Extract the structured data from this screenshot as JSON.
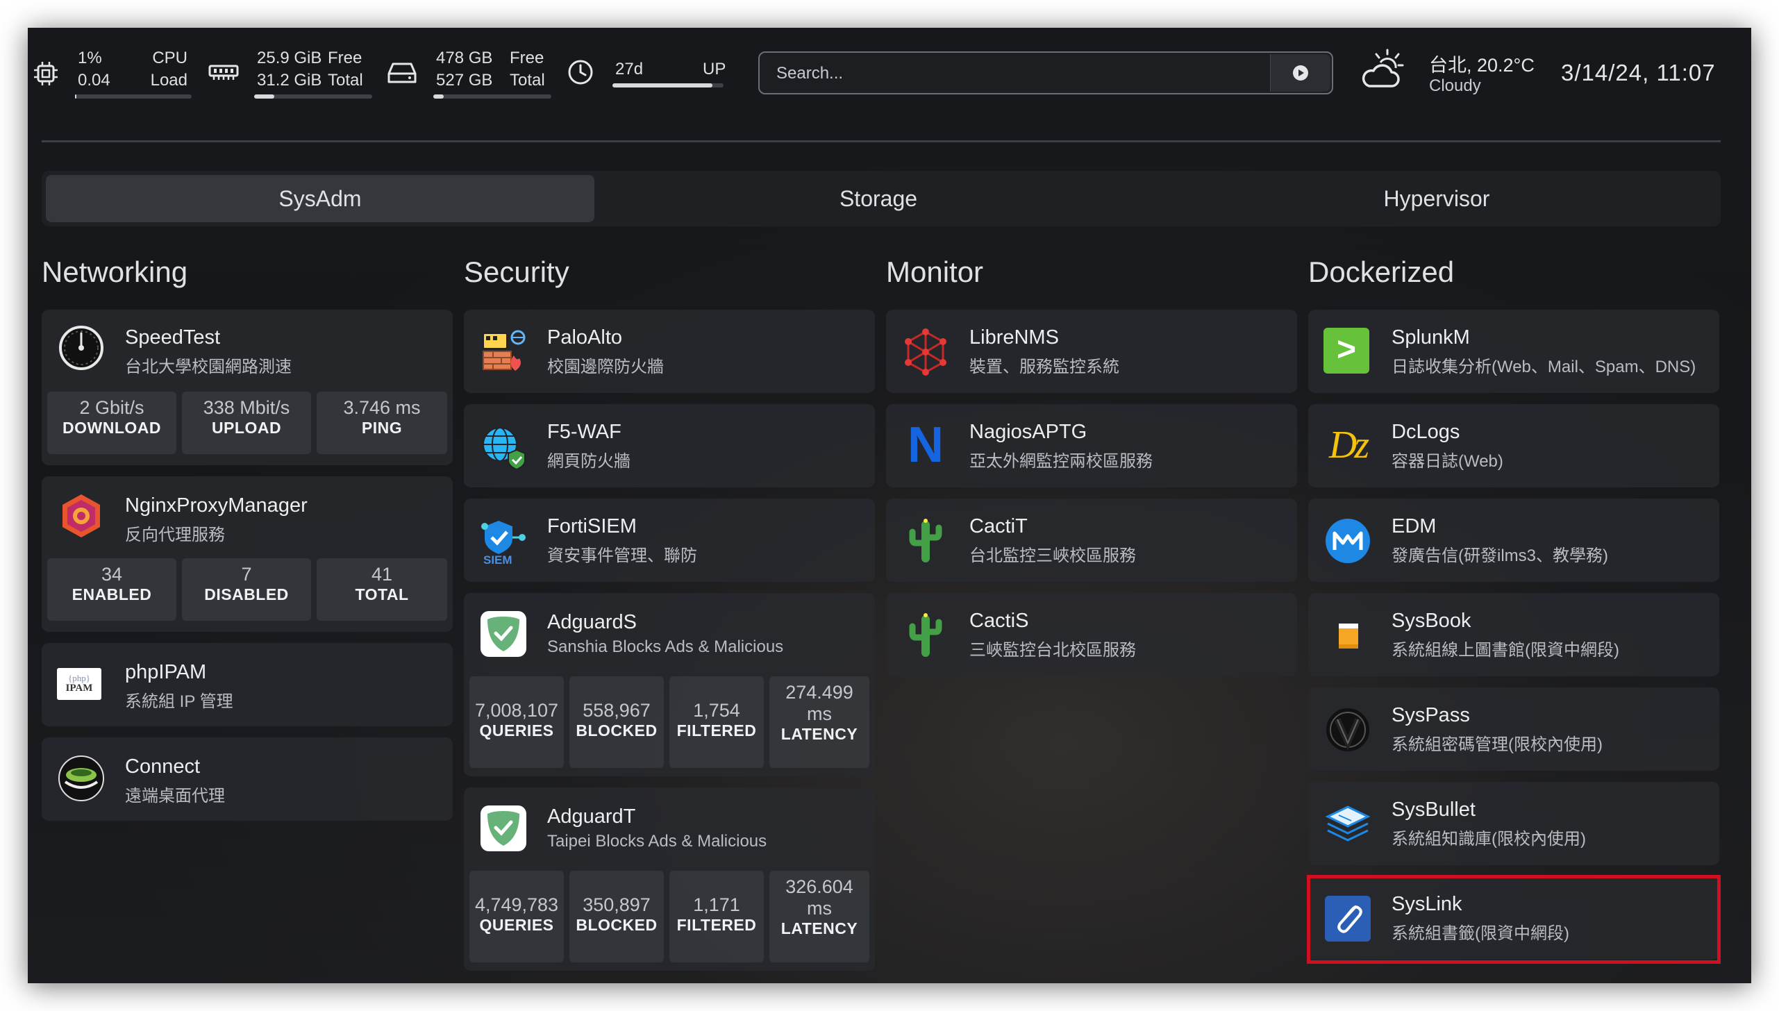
{
  "header": {
    "cpu": {
      "percent": "1%",
      "load": "0.04",
      "label1": "CPU",
      "label2": "Load",
      "usage": 0.01
    },
    "memory": {
      "free": "25.9 GiB",
      "total": "31.2 GiB",
      "label1": "Free",
      "label2": "Total",
      "used_fraction": 0.17
    },
    "disk": {
      "free": "478 GB",
      "total": "527 GB",
      "label1": "Free",
      "label2": "Total",
      "used_fraction": 0.09
    },
    "uptime": {
      "value": "27d",
      "label": "UP",
      "fraction": 0.9
    },
    "search": {
      "placeholder": "Search..."
    },
    "weather": {
      "location_temp": "台北, 20.2°C",
      "condition": "Cloudy"
    },
    "datetime": "3/14/24, 11:07"
  },
  "tabs": [
    {
      "label": "SysAdm",
      "active": true
    },
    {
      "label": "Storage",
      "active": false
    },
    {
      "label": "Hypervisor",
      "active": false
    }
  ],
  "columns": {
    "networking": {
      "title": "Networking",
      "items": [
        {
          "name": "SpeedTest",
          "desc": "台北大學校園網路測速",
          "stats": [
            {
              "v": "2 Gbit/s",
              "l": "DOWNLOAD"
            },
            {
              "v": "338 Mbit/s",
              "l": "UPLOAD"
            },
            {
              "v": "3.746 ms",
              "l": "PING"
            }
          ]
        },
        {
          "name": "NginxProxyManager",
          "desc": "反向代理服務",
          "stats": [
            {
              "v": "34",
              "l": "ENABLED"
            },
            {
              "v": "7",
              "l": "DISABLED"
            },
            {
              "v": "41",
              "l": "TOTAL"
            }
          ]
        },
        {
          "name": "phpIPAM",
          "desc": "系統組 IP 管理",
          "icon_text": [
            "{php}",
            "IPAM"
          ]
        },
        {
          "name": "Connect",
          "desc": "遠端桌面代理"
        }
      ]
    },
    "security": {
      "title": "Security",
      "items": [
        {
          "name": "PaloAlto",
          "desc": "校園邊際防火牆"
        },
        {
          "name": "F5-WAF",
          "desc": "網頁防火牆"
        },
        {
          "name": "FortiSIEM",
          "desc": "資安事件管理、聯防",
          "icon_text": "SIEM"
        },
        {
          "name": "AdguardS",
          "desc": "Sanshia Blocks Ads & Malicious",
          "stats": [
            {
              "v": "7,008,107",
              "l": "QUERIES"
            },
            {
              "v": "558,967",
              "l": "BLOCKED"
            },
            {
              "v": "1,754",
              "l": "FILTERED"
            },
            {
              "v": "274.499",
              "v2": "ms",
              "l": "LATENCY"
            }
          ]
        },
        {
          "name": "AdguardT",
          "desc": "Taipei Blocks Ads & Malicious",
          "stats": [
            {
              "v": "4,749,783",
              "l": "QUERIES"
            },
            {
              "v": "350,897",
              "l": "BLOCKED"
            },
            {
              "v": "1,171",
              "l": "FILTERED"
            },
            {
              "v": "326.604",
              "v2": "ms",
              "l": "LATENCY"
            }
          ]
        }
      ]
    },
    "monitor": {
      "title": "Monitor",
      "items": [
        {
          "name": "LibreNMS",
          "desc": "裝置、服務監控系統"
        },
        {
          "name": "NagiosAPTG",
          "desc": "亞太外網監控兩校區服務",
          "icon_text": "N"
        },
        {
          "name": "CactiT",
          "desc": "台北監控三峽校區服務"
        },
        {
          "name": "CactiS",
          "desc": "三峽監控台北校區服務"
        }
      ]
    },
    "dockerized": {
      "title": "Dockerized",
      "items": [
        {
          "name": "SplunkM",
          "desc": "日誌收集分析(Web、Mail、Spam、DNS)",
          "icon_text": ">"
        },
        {
          "name": "DcLogs",
          "desc": "容器日誌(Web)",
          "icon_text": "Dz"
        },
        {
          "name": "EDM",
          "desc": "發廣告信(研發ilms3、教學務)"
        },
        {
          "name": "SysBook",
          "desc": "系統組線上圖書館(限資中網段)"
        },
        {
          "name": "SysPass",
          "desc": "系統組密碼管理(限校內使用)"
        },
        {
          "name": "SysBullet",
          "desc": "系統組知識庫(限校內使用)"
        },
        {
          "name": "SysLink",
          "desc": "系統組書籤(限資中網段)"
        }
      ]
    }
  },
  "colors": {
    "background": "#16181b",
    "card": "#282a2e",
    "highlight": "#d01020",
    "text": "#e4e6e8"
  }
}
